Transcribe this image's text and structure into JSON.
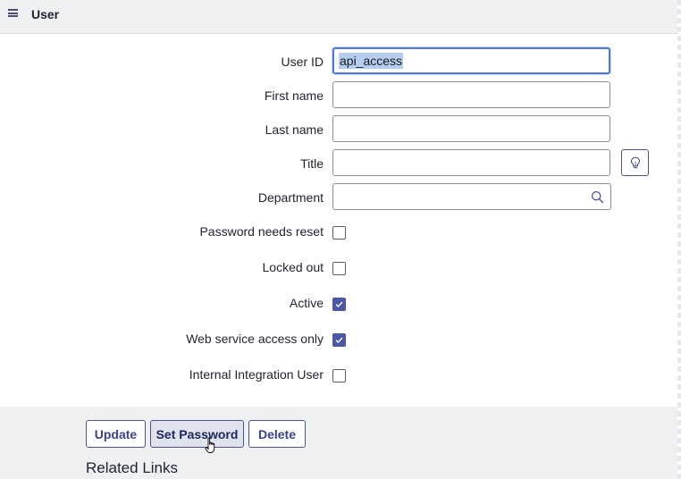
{
  "header": {
    "title": "User"
  },
  "fields": {
    "user_id": {
      "label": "User ID",
      "value": "api_access"
    },
    "first_name": {
      "label": "First name",
      "value": ""
    },
    "last_name": {
      "label": "Last name",
      "value": ""
    },
    "title": {
      "label": "Title",
      "value": ""
    },
    "department": {
      "label": "Department",
      "value": ""
    }
  },
  "checkboxes": {
    "password_needs_reset": {
      "label": "Password needs reset",
      "checked": false
    },
    "locked_out": {
      "label": "Locked out",
      "checked": false
    },
    "active": {
      "label": "Active",
      "checked": true
    },
    "web_service_access_only": {
      "label": "Web service access only",
      "checked": true
    },
    "internal_integration_user": {
      "label": "Internal Integration User",
      "checked": false
    }
  },
  "buttons": {
    "update": "Update",
    "set_password": "Set Password",
    "delete": "Delete"
  },
  "related_links": "Related Links",
  "icons": {
    "menu": "hamburger-menu-icon",
    "search": "search-icon",
    "suggestion": "lightbulb-icon",
    "check": "checkmark-icon"
  },
  "colors": {
    "accent": "#4c56a8",
    "focus": "#4f7bd6",
    "header_bg": "#eef0f1"
  }
}
